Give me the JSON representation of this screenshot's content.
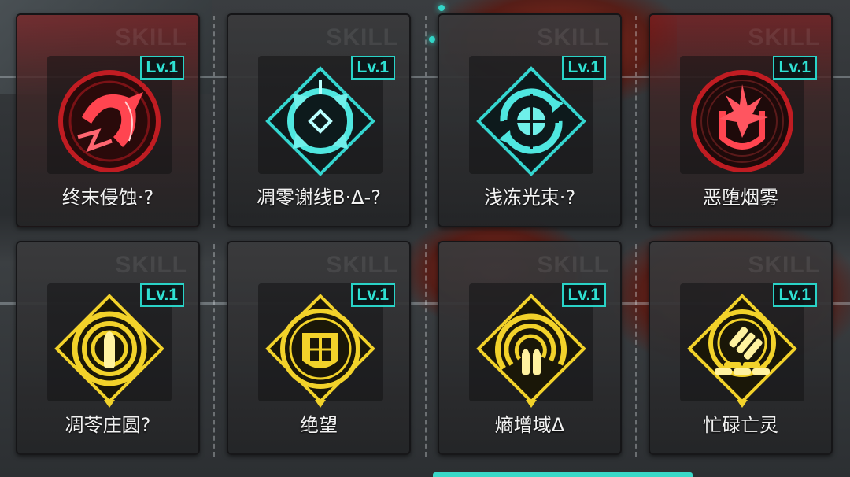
{
  "watermark": "SKILL",
  "accent_color": "#2fe0d2",
  "skills": [
    {
      "name": "终末侵蚀·?",
      "level": "Lv.1",
      "theme": "red",
      "icon": "crimson-claw-icon"
    },
    {
      "name": "凋零谢线B·Δ-?",
      "level": "Lv.1",
      "theme": "teal",
      "icon": "teal-target-arrows-icon"
    },
    {
      "name": "浅冻光束·?",
      "level": "Lv.1",
      "theme": "teal",
      "icon": "teal-crosshair-cycle-icon"
    },
    {
      "name": "恶堕烟雾",
      "level": "Lv.1",
      "theme": "red",
      "icon": "crimson-shield-burst-icon"
    },
    {
      "name": "凋苓庄圆?",
      "level": "Lv.1",
      "theme": "gold",
      "icon": "gold-bullet-rings-icon"
    },
    {
      "name": "绝望",
      "level": "Lv.1",
      "theme": "gold",
      "icon": "gold-window-shield-icon"
    },
    {
      "name": "熵增域Δ",
      "level": "Lv.1",
      "theme": "gold",
      "icon": "gold-spiral-bullets-icon"
    },
    {
      "name": "忙碌亡灵",
      "level": "Lv.1",
      "theme": "gold",
      "icon": "gold-ammo-stack-icon"
    }
  ]
}
